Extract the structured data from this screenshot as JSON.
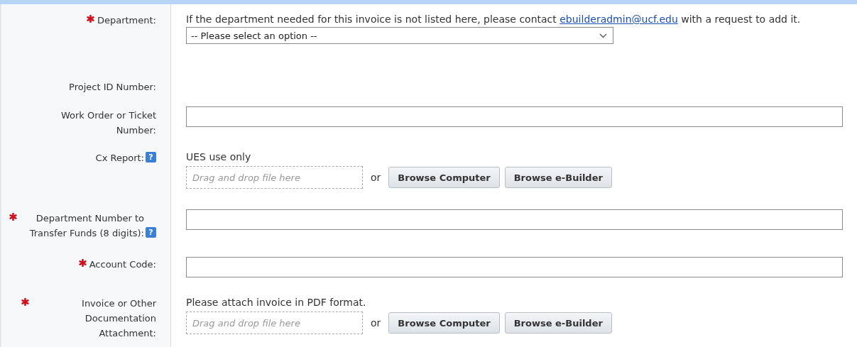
{
  "fields": [
    {
      "kind": "select",
      "label": "Department:",
      "required": true,
      "note": {
        "before": "If the department needed for this invoice is not listed here, please contact ",
        "link": "ebuilderadmin@ucf.edu",
        "after": " with a request to add it."
      },
      "placeholder": "-- Please select an option --"
    },
    {
      "kind": "readonly",
      "label": "Project ID Number:",
      "required": false
    },
    {
      "kind": "text",
      "label": "Work Order or Ticket Number:",
      "required": false
    },
    {
      "kind": "file",
      "label": "Cx Report:",
      "required": false,
      "help": "?",
      "note": {
        "before": "UES use only"
      },
      "drop_placeholder": "Drag and drop file here",
      "or_text": "or",
      "buttons": [
        "Browse Computer",
        "Browse e-Builder"
      ]
    },
    {
      "kind": "text",
      "label": "Department Number to Transfer Funds (8 digits):",
      "required": true,
      "help": "?"
    },
    {
      "kind": "text",
      "label": "Account Code:",
      "required": true
    },
    {
      "kind": "file",
      "label": "Invoice or Other Documentation Attachment:",
      "required": true,
      "note": {
        "before": "Please attach invoice in PDF format."
      },
      "drop_placeholder": "Drag and drop file here",
      "or_text": "or",
      "buttons": [
        "Browse Computer",
        "Browse e-Builder"
      ]
    }
  ]
}
